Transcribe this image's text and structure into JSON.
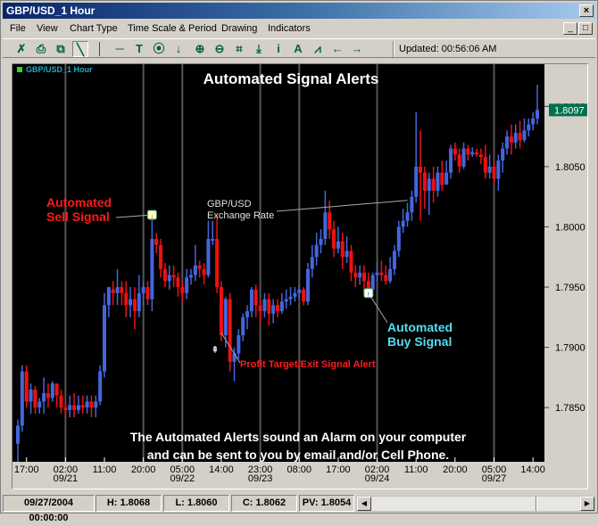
{
  "window": {
    "title": "GBP/USD_1 Hour",
    "close_glyph": "×",
    "minimize_glyph": "_",
    "maximize_glyph": "□"
  },
  "menu": [
    "File",
    "View",
    "Chart Type",
    "Time Scale & Period",
    "Drawing",
    "Indicators"
  ],
  "toolbar": {
    "icons": [
      {
        "name": "cross-delete-icon",
        "glyph": "✗"
      },
      {
        "name": "print-icon",
        "glyph": "⎙"
      },
      {
        "name": "copy-window-icon",
        "glyph": "⧉"
      },
      {
        "name": "trend-line-icon",
        "glyph": "╲"
      },
      {
        "name": "vertical-line-icon",
        "glyph": "│"
      },
      {
        "name": "horizontal-line-icon",
        "glyph": "─"
      },
      {
        "name": "text-tool-icon",
        "glyph": "T"
      },
      {
        "name": "circle-target-icon",
        "glyph": "⦿"
      },
      {
        "name": "arrow-down-icon",
        "glyph": "↓"
      },
      {
        "name": "zoom-in-icon",
        "glyph": "⊕"
      },
      {
        "name": "zoom-out-icon",
        "glyph": "⊖"
      },
      {
        "name": "fit-scale-icon",
        "glyph": "⌗"
      },
      {
        "name": "download-icon",
        "glyph": "⤓"
      },
      {
        "name": "info-icon",
        "glyph": "i"
      },
      {
        "name": "font-icon",
        "glyph": "A"
      },
      {
        "name": "indicator-icon",
        "glyph": "⩘"
      },
      {
        "name": "arrow-left-icon",
        "glyph": "←"
      },
      {
        "name": "arrow-right-icon",
        "glyph": "→"
      }
    ],
    "updated": "Updated: 00:56:06 AM"
  },
  "status": {
    "datetime": "09/27/2004 00:00:00",
    "high": "H: 1.8068",
    "low": "L: 1.8060",
    "close": "C: 1.8062",
    "pv": "PV: 1.8054"
  },
  "scroll": {
    "left_glyph": "◀",
    "right_glyph": "▶"
  },
  "chart_data": {
    "type": "candlestick",
    "title": "Automated Signal Alerts",
    "symbol_label": "GBP/USD_1 Hour",
    "ylim": [
      1.7805,
      1.8135
    ],
    "y_ticks": [
      "1.8100",
      "1.8050",
      "1.8000",
      "1.7950",
      "1.7900",
      "1.7850"
    ],
    "y_tick_values": [
      1.81,
      1.805,
      1.8,
      1.795,
      1.79,
      1.785
    ],
    "current_price": "1.8097",
    "current_price_value": 1.8097,
    "x_ticks": [
      {
        "time": "17:00",
        "date": ""
      },
      {
        "time": "02:00",
        "date": "09/21"
      },
      {
        "time": "11:00",
        "date": ""
      },
      {
        "time": "20:00",
        "date": ""
      },
      {
        "time": "05:00",
        "date": "09/22"
      },
      {
        "time": "14:00",
        "date": ""
      },
      {
        "time": "23:00",
        "date": "09/23"
      },
      {
        "time": "08:00",
        "date": ""
      },
      {
        "time": "17:00",
        "date": ""
      },
      {
        "time": "02:00",
        "date": "09/24"
      },
      {
        "time": "11:00",
        "date": ""
      },
      {
        "time": "20:00",
        "date": ""
      },
      {
        "time": "05:00",
        "date": "09/27"
      },
      {
        "time": "14:00",
        "date": ""
      }
    ],
    "colors": {
      "up": "#4466dd",
      "down": "#ee1111",
      "background": "#000000",
      "grid": "#555555",
      "price_tag": "#007050"
    },
    "candles": [
      [
        1.782,
        1.7835,
        1.7805,
        1.784
      ],
      [
        1.7835,
        1.788,
        1.783,
        1.7885
      ],
      [
        1.788,
        1.7855,
        1.785,
        1.7885
      ],
      [
        1.7855,
        1.7865,
        1.7845,
        1.787
      ],
      [
        1.7865,
        1.785,
        1.7845,
        1.7868
      ],
      [
        1.785,
        1.7855,
        1.7845,
        1.7858
      ],
      [
        1.7855,
        1.7862,
        1.7845,
        1.7875
      ],
      [
        1.7862,
        1.7858,
        1.785,
        1.787
      ],
      [
        1.7858,
        1.787,
        1.7855,
        1.7872
      ],
      [
        1.787,
        1.786,
        1.785,
        1.7868
      ],
      [
        1.786,
        1.785,
        1.7845,
        1.7865
      ],
      [
        1.785,
        1.7848,
        1.7842,
        1.7858
      ],
      [
        1.7848,
        1.7852,
        1.7842,
        1.786
      ],
      [
        1.7852,
        1.7848,
        1.7842,
        1.7862
      ],
      [
        1.7848,
        1.7852,
        1.7845,
        1.786
      ],
      [
        1.7852,
        1.785,
        1.7845,
        1.786
      ],
      [
        1.785,
        1.7855,
        1.7845,
        1.786
      ],
      [
        1.7855,
        1.785,
        1.7842,
        1.786
      ],
      [
        1.785,
        1.7855,
        1.7842,
        1.786
      ],
      [
        1.7855,
        1.788,
        1.7852,
        1.7885
      ],
      [
        1.788,
        1.7935,
        1.7875,
        1.7945
      ],
      [
        1.7935,
        1.795,
        1.7925,
        1.7945
      ],
      [
        1.7948,
        1.7945,
        1.7935,
        1.7955
      ],
      [
        1.7945,
        1.795,
        1.7935,
        1.7965
      ],
      [
        1.795,
        1.7945,
        1.7935,
        1.7955
      ],
      [
        1.7945,
        1.7935,
        1.7925,
        1.7955
      ],
      [
        1.7935,
        1.794,
        1.7925,
        1.795
      ],
      [
        1.794,
        1.793,
        1.7915,
        1.795
      ],
      [
        1.793,
        1.7945,
        1.7925,
        1.796
      ],
      [
        1.7945,
        1.795,
        1.7935,
        1.7955
      ],
      [
        1.795,
        1.794,
        1.7935,
        1.7955
      ],
      [
        1.794,
        1.799,
        1.793,
        1.801
      ],
      [
        1.799,
        1.7985,
        1.7978,
        1.7995
      ],
      [
        1.7985,
        1.7965,
        1.7958,
        1.799
      ],
      [
        1.7965,
        1.7955,
        1.795,
        1.797
      ],
      [
        1.7955,
        1.796,
        1.7948,
        1.7968
      ],
      [
        1.796,
        1.7958,
        1.795,
        1.7968
      ],
      [
        1.7958,
        1.795,
        1.7942,
        1.7962
      ],
      [
        1.795,
        1.7945,
        1.7938,
        1.7955
      ],
      [
        1.7945,
        1.7958,
        1.794,
        1.7965
      ],
      [
        1.7958,
        1.796,
        1.7952,
        1.7965
      ],
      [
        1.796,
        1.7968,
        1.7955,
        1.7985
      ],
      [
        1.7968,
        1.7965,
        1.7958,
        1.7972
      ],
      [
        1.7965,
        1.796,
        1.7952,
        1.797
      ],
      [
        1.796,
        1.799,
        1.7958,
        1.8005
      ],
      [
        1.799,
        1.799,
        1.7985,
        1.8005
      ],
      [
        1.799,
        1.795,
        1.7945,
        1.801
      ],
      [
        1.795,
        1.791,
        1.7905,
        1.7955
      ],
      [
        1.791,
        1.794,
        1.79,
        1.7942
      ],
      [
        1.794,
        1.7888,
        1.788,
        1.7945
      ],
      [
        1.7888,
        1.7895,
        1.7872,
        1.79
      ],
      [
        1.7895,
        1.791,
        1.789,
        1.7915
      ],
      [
        1.791,
        1.7925,
        1.7905,
        1.7928
      ],
      [
        1.7925,
        1.793,
        1.7915,
        1.7935
      ],
      [
        1.793,
        1.7948,
        1.7925,
        1.795
      ],
      [
        1.7948,
        1.7935,
        1.7925,
        1.7952
      ],
      [
        1.7935,
        1.793,
        1.792,
        1.794
      ],
      [
        1.793,
        1.794,
        1.7925,
        1.7945
      ],
      [
        1.794,
        1.7928,
        1.7918,
        1.7945
      ],
      [
        1.7928,
        1.7935,
        1.792,
        1.794
      ],
      [
        1.7935,
        1.793,
        1.7925,
        1.794
      ],
      [
        1.793,
        1.7938,
        1.7928,
        1.7945
      ],
      [
        1.7938,
        1.794,
        1.7932,
        1.7948
      ],
      [
        1.794,
        1.7942,
        1.7935,
        1.795
      ],
      [
        1.7942,
        1.7945,
        1.7938,
        1.795
      ],
      [
        1.7945,
        1.7948,
        1.794,
        1.7952
      ],
      [
        1.7948,
        1.7938,
        1.7935,
        1.795
      ],
      [
        1.7938,
        1.7965,
        1.7935,
        1.797
      ],
      [
        1.7965,
        1.7975,
        1.7958,
        1.7985
      ],
      [
        1.7975,
        1.7985,
        1.7968,
        1.7995
      ],
      [
        1.7985,
        1.799,
        1.7978,
        1.7998
      ],
      [
        1.799,
        1.8012,
        1.7985,
        1.803
      ],
      [
        1.8012,
        1.7998,
        1.799,
        1.8022
      ],
      [
        1.7998,
        1.7982,
        1.7975,
        1.8005
      ],
      [
        1.7982,
        1.7988,
        1.7978,
        1.8
      ],
      [
        1.7988,
        1.7975,
        1.7965,
        1.7995
      ],
      [
        1.7975,
        1.798,
        1.797,
        1.7992
      ],
      [
        1.798,
        1.7962,
        1.7955,
        1.7985
      ],
      [
        1.7962,
        1.7958,
        1.795,
        1.7968
      ],
      [
        1.7958,
        1.7962,
        1.7952,
        1.7968
      ],
      [
        1.7962,
        1.7955,
        1.7945,
        1.7968
      ],
      [
        1.7955,
        1.7948,
        1.7945,
        1.7962
      ],
      [
        1.7948,
        1.796,
        1.7947,
        1.7962
      ],
      [
        1.796,
        1.7962,
        1.7955,
        1.797
      ],
      [
        1.7962,
        1.796,
        1.7955,
        1.7972
      ],
      [
        1.796,
        1.7955,
        1.7952,
        1.7968
      ],
      [
        1.7955,
        1.7965,
        1.7953,
        1.7975
      ],
      [
        1.7965,
        1.798,
        1.796,
        1.7985
      ],
      [
        1.798,
        1.8,
        1.7975,
        1.8005
      ],
      [
        1.8,
        1.8005,
        1.7995,
        1.8015
      ],
      [
        1.8005,
        1.8012,
        1.8,
        1.802
      ],
      [
        1.8012,
        1.8025,
        1.8005,
        1.803
      ],
      [
        1.8025,
        1.805,
        1.802,
        1.8095
      ],
      [
        1.805,
        1.8045,
        1.8005,
        1.808
      ],
      [
        1.8045,
        1.803,
        1.8015,
        1.805
      ],
      [
        1.803,
        1.804,
        1.801,
        1.8045
      ],
      [
        1.804,
        1.803,
        1.802,
        1.805
      ],
      [
        1.803,
        1.8045,
        1.8025,
        1.805
      ],
      [
        1.8045,
        1.8035,
        1.803,
        1.8055
      ],
      [
        1.8035,
        1.8045,
        1.8035,
        1.8055
      ],
      [
        1.8045,
        1.8065,
        1.804,
        1.8068
      ],
      [
        1.8065,
        1.806,
        1.8055,
        1.807
      ],
      [
        1.806,
        1.805,
        1.8045,
        1.8065
      ],
      [
        1.805,
        1.8065,
        1.8048,
        1.807
      ],
      [
        1.8065,
        1.806,
        1.8055,
        1.8068
      ],
      [
        1.806,
        1.8062,
        1.8058,
        1.8066
      ],
      [
        1.8062,
        1.806,
        1.8058,
        1.8065
      ],
      [
        1.806,
        1.8058,
        1.8052,
        1.8065
      ],
      [
        1.8058,
        1.8045,
        1.804,
        1.8068
      ],
      [
        1.8045,
        1.805,
        1.804,
        1.806
      ],
      [
        1.805,
        1.804,
        1.8035,
        1.8055
      ],
      [
        1.804,
        1.8055,
        1.803,
        1.806
      ],
      [
        1.8055,
        1.8065,
        1.8045,
        1.807
      ],
      [
        1.8065,
        1.8075,
        1.806,
        1.808
      ],
      [
        1.8075,
        1.807,
        1.806,
        1.8085
      ],
      [
        1.807,
        1.8078,
        1.8065,
        1.8085
      ],
      [
        1.8078,
        1.8072,
        1.8065,
        1.8088
      ],
      [
        1.8072,
        1.808,
        1.807,
        1.809
      ],
      [
        1.808,
        1.8085,
        1.8075,
        1.809
      ],
      [
        1.8085,
        1.809,
        1.808,
        1.8095
      ],
      [
        1.809,
        1.8097,
        1.8085,
        1.8118
      ]
    ],
    "annotations": [
      {
        "text": [
          "Automated",
          "Sell Signal"
        ],
        "color": "#ff1a1a",
        "target_index": 31,
        "target_price": 1.801,
        "marker": "sell"
      },
      {
        "text": [
          "GBP/USD",
          "Exchange Rate"
        ],
        "color": "#e0e0e0",
        "target_index": 90,
        "target_price": 1.8022,
        "marker": "none"
      },
      {
        "text": [
          "Automated",
          "Buy Signal"
        ],
        "color": "#55ddee",
        "target_index": 81,
        "target_price": 1.7945,
        "marker": "buy"
      },
      {
        "text": [
          "Profit Target/Exit Signal Alert"
        ],
        "color": "#ff1a1a",
        "target_index": 47,
        "target_price": 1.7912,
        "marker": "exit"
      }
    ],
    "footer_text": [
      "The Automated Alerts sound an Alarm on your computer",
      "and can be sent to you by email and/or Cell Phone."
    ]
  }
}
